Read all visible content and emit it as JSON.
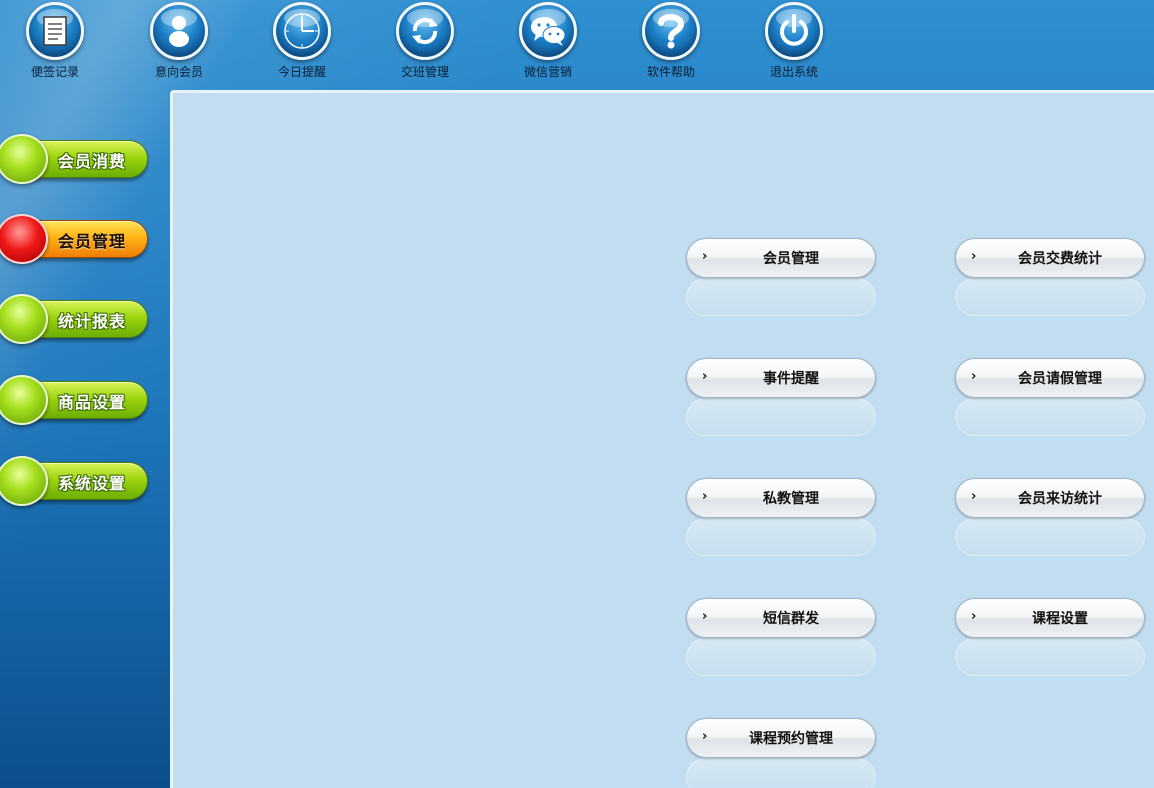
{
  "toolbar": {
    "items": [
      {
        "label": "便签记录",
        "icon": "notepad-icon"
      },
      {
        "label": "意向会员",
        "icon": "member-icon"
      },
      {
        "label": "今日提醒",
        "icon": "clock-icon"
      },
      {
        "label": "交班管理",
        "icon": "refresh-icon"
      },
      {
        "label": "微信营销",
        "icon": "wechat-icon"
      },
      {
        "label": "软件帮助",
        "icon": "help-icon"
      },
      {
        "label": "退出系统",
        "icon": "power-icon"
      }
    ]
  },
  "sidebar": {
    "items": [
      {
        "label": "会员消费",
        "active": false
      },
      {
        "label": "会员管理",
        "active": true
      },
      {
        "label": "统计报表",
        "active": false
      },
      {
        "label": "商品设置",
        "active": false
      },
      {
        "label": "系统设置",
        "active": false
      }
    ]
  },
  "main": {
    "buttons": [
      {
        "label": "会员管理"
      },
      {
        "label": "会员交费统计"
      },
      {
        "label": "事件提醒"
      },
      {
        "label": "会员请假管理"
      },
      {
        "label": "私教管理"
      },
      {
        "label": "会员来访统计"
      },
      {
        "label": "短信群发"
      },
      {
        "label": "课程设置"
      },
      {
        "label": "课程预约管理"
      }
    ],
    "arrow": "›"
  },
  "colors": {
    "frame_blue": "#1f78bd",
    "content_bg": "#c1ddef",
    "nav_green": "#9ed40f",
    "nav_active_orange": "#ffb416",
    "nav_active_ball_red": "#f01818"
  }
}
